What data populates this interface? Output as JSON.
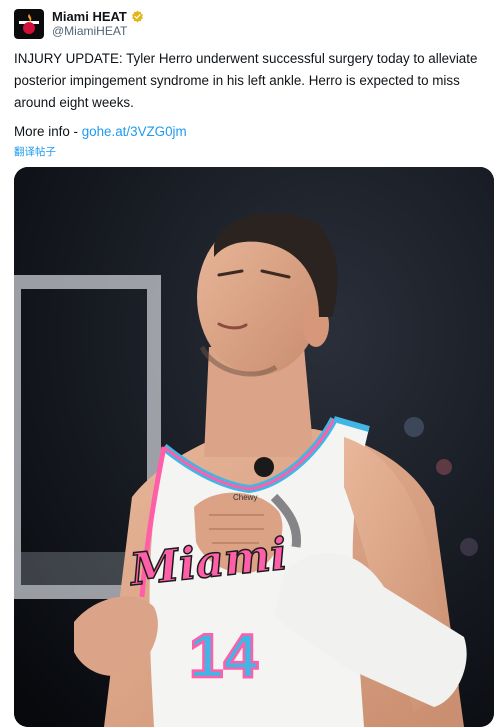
{
  "account": {
    "display_name": "Miami HEAT",
    "handle": "@MiamiHEAT",
    "verified_badge_icon": "verified-gold-badge-icon",
    "avatar_icon": "miami-heat-logo-icon"
  },
  "tweet": {
    "text": "INJURY UPDATE: Tyler Herro underwent successful surgery today to alleviate posterior impingement syndrome in his left ankle. Herro is expected to miss around eight weeks.",
    "more_info_prefix": "More info - ",
    "link_text": "gohe.at/3VZG0jm",
    "translate_label": "翻译帖子"
  },
  "media": {
    "jersey_wordmark": "Miami",
    "jersey_number": "14",
    "sponsor_patch": "Chewy",
    "description_icon": "player-photo-image"
  },
  "colors": {
    "link": "#1d9bf0",
    "verified_badge": "#e2b719",
    "jersey_pink": "#ff5fa8",
    "jersey_blue": "#41b6e6"
  }
}
